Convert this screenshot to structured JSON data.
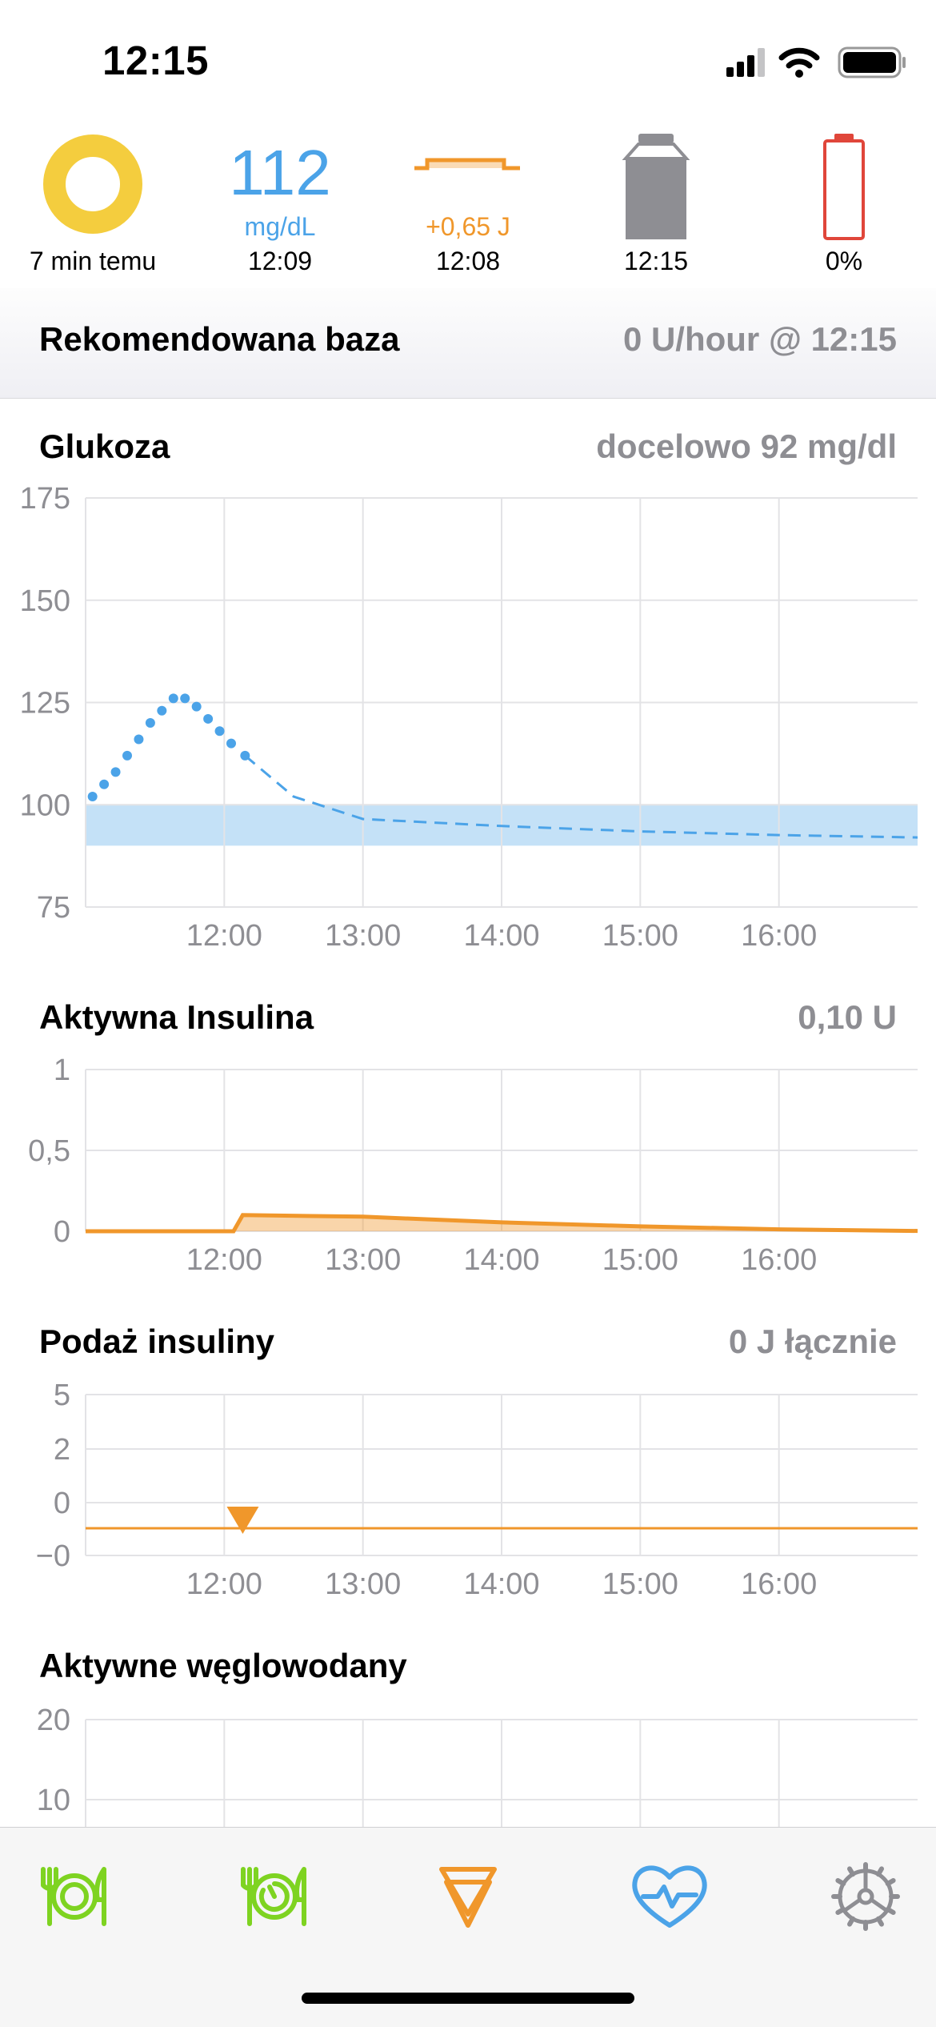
{
  "status_bar": {
    "time": "12:15"
  },
  "hud": {
    "loop_status": "7 min temu",
    "glucose_value": "112",
    "glucose_unit": "mg/dL",
    "glucose_time": "12:09",
    "temp_basal_value": "+0,65 J",
    "temp_basal_time": "12:08",
    "reservoir_time": "12:15",
    "battery_percent": "0%",
    "colors": {
      "loop_ring": "#f4cd3e",
      "glucose": "#4ba3e8",
      "insulin": "#f0972b",
      "battery_low": "#e0463a",
      "reservoir": "#8e8e93"
    }
  },
  "recommendation": {
    "title": "Rekomendowana baza",
    "value": "0 U/hour @ 12:15"
  },
  "time_labels": [
    "12:00",
    "13:00",
    "14:00",
    "15:00",
    "16:00"
  ],
  "glucose_section": {
    "title": "Glukoza",
    "target_label": "docelowo 92 mg/dl"
  },
  "insulin_section": {
    "title": "Aktywna Insulina",
    "value": "0,10 U"
  },
  "delivery_section": {
    "title": "Podaż insuliny",
    "value": "0 J łącznie"
  },
  "carbs_section": {
    "title": "Aktywne węglowodany"
  },
  "chart_data": [
    {
      "id": "glucose",
      "type": "scatter",
      "y_ticks": [
        "175",
        "150",
        "125",
        "100",
        "75"
      ],
      "ylim": [
        75,
        175
      ],
      "xlim": [
        "11:00",
        "17:00"
      ],
      "target_range": [
        90,
        100
      ],
      "series": [
        {
          "values": [
            {
              "x": "11:03",
              "y": 102
            },
            {
              "x": "11:08",
              "y": 105
            },
            {
              "x": "11:13",
              "y": 108
            },
            {
              "x": "11:18",
              "y": 112
            },
            {
              "x": "11:23",
              "y": 116
            },
            {
              "x": "11:28",
              "y": 120
            },
            {
              "x": "11:33",
              "y": 123
            },
            {
              "x": "11:38",
              "y": 126
            },
            {
              "x": "11:43",
              "y": 126
            },
            {
              "x": "11:48",
              "y": 124
            },
            {
              "x": "11:53",
              "y": 121
            },
            {
              "x": "11:58",
              "y": 118
            },
            {
              "x": "12:03",
              "y": 115
            },
            {
              "x": "12:09",
              "y": 112
            }
          ]
        },
        {
          "style": "dashed",
          "values": [
            {
              "x": "12:09",
              "y": 112
            },
            {
              "x": "12:30",
              "y": 102
            },
            {
              "x": "13:00",
              "y": 96.5
            },
            {
              "x": "14:00",
              "y": 94.8
            },
            {
              "x": "15:00",
              "y": 93.5
            },
            {
              "x": "16:00",
              "y": 92.6
            },
            {
              "x": "17:00",
              "y": 92
            }
          ]
        }
      ]
    },
    {
      "id": "active_insulin",
      "type": "area",
      "y_ticks": [
        "1",
        "0,5",
        "0"
      ],
      "ylim": [
        0,
        1
      ],
      "xlim": [
        "11:00",
        "17:00"
      ],
      "series": [
        {
          "values": [
            {
              "x": "11:00",
              "y": 0
            },
            {
              "x": "12:04",
              "y": 0
            },
            {
              "x": "12:08",
              "y": 0.1
            },
            {
              "x": "13:00",
              "y": 0.09
            },
            {
              "x": "14:00",
              "y": 0.055
            },
            {
              "x": "15:00",
              "y": 0.03
            },
            {
              "x": "16:00",
              "y": 0.012
            },
            {
              "x": "17:00",
              "y": 0.002
            }
          ]
        }
      ]
    },
    {
      "id": "insulin_delivery",
      "type": "line",
      "y_ticks": [
        "5",
        "2",
        "0",
        "−0"
      ],
      "xlim": [
        "11:00",
        "17:00"
      ],
      "basal_line_label_position": "−0",
      "bolus_marker_time": "12:08"
    },
    {
      "id": "active_carbs",
      "type": "line",
      "y_ticks": [
        "20",
        "10"
      ],
      "xlim": [
        "11:00",
        "17:00"
      ]
    }
  ],
  "tab_bar": {
    "items": [
      {
        "name": "add-carbs",
        "icon": "fork-plate-knife-icon"
      },
      {
        "name": "pre-meal",
        "icon": "plate-timer-icon"
      },
      {
        "name": "bolus",
        "icon": "bolus-triangle-icon"
      },
      {
        "name": "workout",
        "icon": "heart-pulse-icon"
      },
      {
        "name": "settings",
        "icon": "gear-icon"
      }
    ]
  }
}
